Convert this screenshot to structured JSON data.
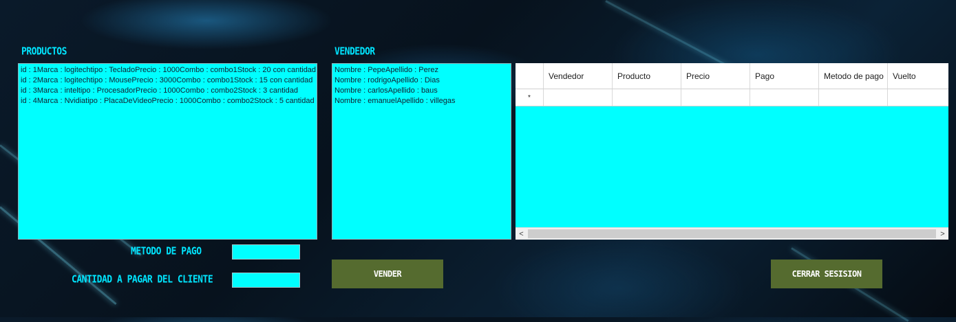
{
  "labels": {
    "productos": "PRODUCTOS",
    "vendedor": "VENDEDOR",
    "metodo_pago": "METODO DE PAGO",
    "cantidad": "CANTIDAD A PAGAR DEL CLIENTE"
  },
  "productos": [
    "id : 1Marca : logitechtipo : TecladoPrecio : 1000Combo : combo1Stock : 20 con cantidad",
    "id : 2Marca : logitechtipo : MousePrecio : 3000Combo : combo1Stock : 15 con cantidad",
    "id : 3Marca : inteltipo : ProcesadorPrecio : 1000Combo : combo2Stock : 3 cantidad",
    "id : 4Marca : Nvidiatipo : PlacaDeVideoPrecio : 1000Combo : combo2Stock : 5 cantidad"
  ],
  "vendedores": [
    "Nombre : PepeApellido : Perez",
    "Nombre : rodrigoApellido : Dias",
    "Nombre : carlosApellido : baus",
    "Nombre : emanuelApellido : villegas"
  ],
  "grid": {
    "columns": [
      "Vendedor",
      "Producto",
      "Precio",
      "Pago",
      "Metodo de pago",
      "Vuelto"
    ],
    "new_row_marker": "*"
  },
  "inputs": {
    "metodo_pago_value": "",
    "cantidad_value": ""
  },
  "buttons": {
    "vender": "VENDER",
    "cerrar_sesion": "CERRAR SESISION"
  },
  "scroll": {
    "left_arrow": "<",
    "right_arrow": ">"
  }
}
